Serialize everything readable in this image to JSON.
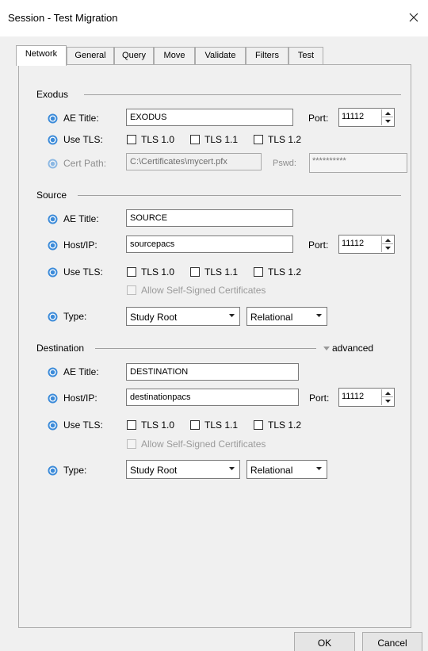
{
  "window": {
    "title": "Session - Test Migration"
  },
  "tabs": [
    "Network",
    "General",
    "Query",
    "Move",
    "Validate",
    "Filters",
    "Test"
  ],
  "exodus": {
    "group_label": "Exodus",
    "ae_title_label": "AE Title:",
    "ae_title_value": "EXODUS",
    "port_label": "Port:",
    "port_value": "11112",
    "use_tls_label": "Use TLS:",
    "tls": [
      "TLS 1.0",
      "TLS 1.1",
      "TLS 1.2"
    ],
    "cert_path_label": "Cert Path:",
    "cert_path_value": "C:\\Certificates\\mycert.pfx",
    "pswd_label": "Pswd:",
    "pswd_value": "**********"
  },
  "source": {
    "group_label": "Source",
    "ae_title_label": "AE Title:",
    "ae_title_value": "SOURCE",
    "host_label": "Host/IP:",
    "host_value": "sourcepacs",
    "port_label": "Port:",
    "port_value": "11112",
    "use_tls_label": "Use TLS:",
    "tls": [
      "TLS 1.0",
      "TLS 1.1",
      "TLS 1.2"
    ],
    "allow_self_signed_label": "Allow Self-Signed Certificates",
    "type_label": "Type:",
    "type_value": "Study Root",
    "model_value": "Relational"
  },
  "destination": {
    "group_label": "Destination",
    "advanced_label": "advanced",
    "ae_title_label": "AE Title:",
    "ae_title_value": "DESTINATION",
    "host_label": "Host/IP:",
    "host_value": "destinationpacs",
    "port_label": "Port:",
    "port_value": "11112",
    "use_tls_label": "Use TLS:",
    "tls": [
      "TLS 1.0",
      "TLS 1.1",
      "TLS 1.2"
    ],
    "allow_self_signed_label": "Allow Self-Signed Certificates",
    "type_label": "Type:",
    "type_value": "Study Root",
    "model_value": "Relational"
  },
  "footer": {
    "ok_label": "OK",
    "cancel_label": "Cancel"
  },
  "icons": {
    "help": "help-icon",
    "close": "close-icon",
    "spin_up": "arrow-up-icon",
    "spin_down": "arrow-down-icon",
    "dropdown": "chevron-down-icon",
    "advanced": "triangle-down-icon"
  },
  "colors": {
    "help_icon_fill": "#3c8bd9",
    "window_bg": "#f0f0f0"
  }
}
